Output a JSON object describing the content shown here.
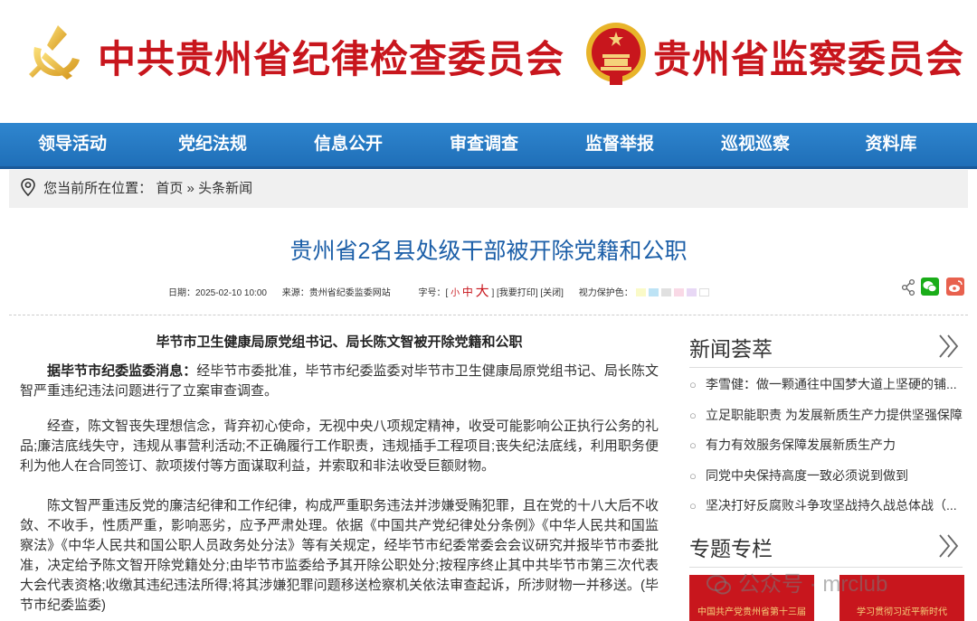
{
  "header": {
    "title_ccdi": "中共贵州省纪律检查委员会",
    "title_supervision": "贵州省监察委员会"
  },
  "nav": {
    "items": [
      "领导活动",
      "党纪法规",
      "信息公开",
      "审查调查",
      "监督举报",
      "巡视巡察",
      "资料库"
    ]
  },
  "breadcrumb": {
    "prefix": "您当前所在位置：",
    "home": "首页",
    "sep": "»",
    "current": "头条新闻"
  },
  "article": {
    "title": "贵州省2名县处级干部被开除党籍和公职",
    "meta": {
      "date": "日期：2025-02-10 10:00",
      "source": "来源：贵州省纪委监委网站",
      "font_label": "字号：[",
      "font_small": "小",
      "font_mid": "中",
      "font_big": "大",
      "font_close": "]",
      "print": "[我要打印]",
      "close": "[关闭]",
      "eye_label": "视力保护色："
    },
    "eye_colors": [
      "#fafac8",
      "#bde3f5",
      "#e0e0e0",
      "#f9d9e6",
      "#e8d8f5",
      "#ffffff"
    ],
    "subhead": "毕节市卫生健康局原党组书记、局长陈文智被开除党籍和公职",
    "p1_lead": "据毕节市纪委监委消息：",
    "p1": "经毕节市委批准，毕节市纪委监委对毕节市卫生健康局原党组书记、局长陈文智严重违纪违法问题进行了立案审查调查。",
    "p2": "经查，陈文智丧失理想信念，背弃初心使命，无视中央八项规定精神，收受可能影响公正执行公务的礼品;廉洁底线失守，违规从事营利活动;不正确履行工作职责，违规插手工程项目;丧失纪法底线，利用职务便利为他人在合同签订、款项拨付等方面谋取利益，并索取和非法收受巨额财物。",
    "p3": "陈文智严重违反党的廉洁纪律和工作纪律，构成严重职务违法并涉嫌受贿犯罪，且在党的十八大后不收敛、不收手，性质严重，影响恶劣，应予严肃处理。依据《中国共产党纪律处分条例》《中华人民共和国监察法》《中华人民共和国公职人员政务处分法》等有关规定，经毕节市纪委常委会会议研究并报毕节市委批准，决定给予陈文智开除党籍处分;由毕节市监委给予其开除公职处分;按程序终止其中共毕节市第三次代表大会代表资格;收缴其违纪违法所得;将其涉嫌犯罪问题移送检察机关依法审查起诉，所涉财物一并移送。(毕节市纪委监委)"
  },
  "sidebar": {
    "news_title": "新闻荟萃",
    "news": [
      "李雪健：做一颗通往中国梦大道上坚硬的铺...",
      "立足职能职责 为发展新质生产力提供坚强保障",
      "有力有效服务保障发展新质生产力",
      "同党中央保持高度一致必须说到做到",
      "坚决打好反腐败斗争攻坚战持久战总体战（..."
    ],
    "topics_title": "专题专栏",
    "topics": [
      "中国共产党贵州省第十三届",
      "学习贯彻习近平新时代"
    ]
  },
  "watermark": "公众号 · mrclub"
}
